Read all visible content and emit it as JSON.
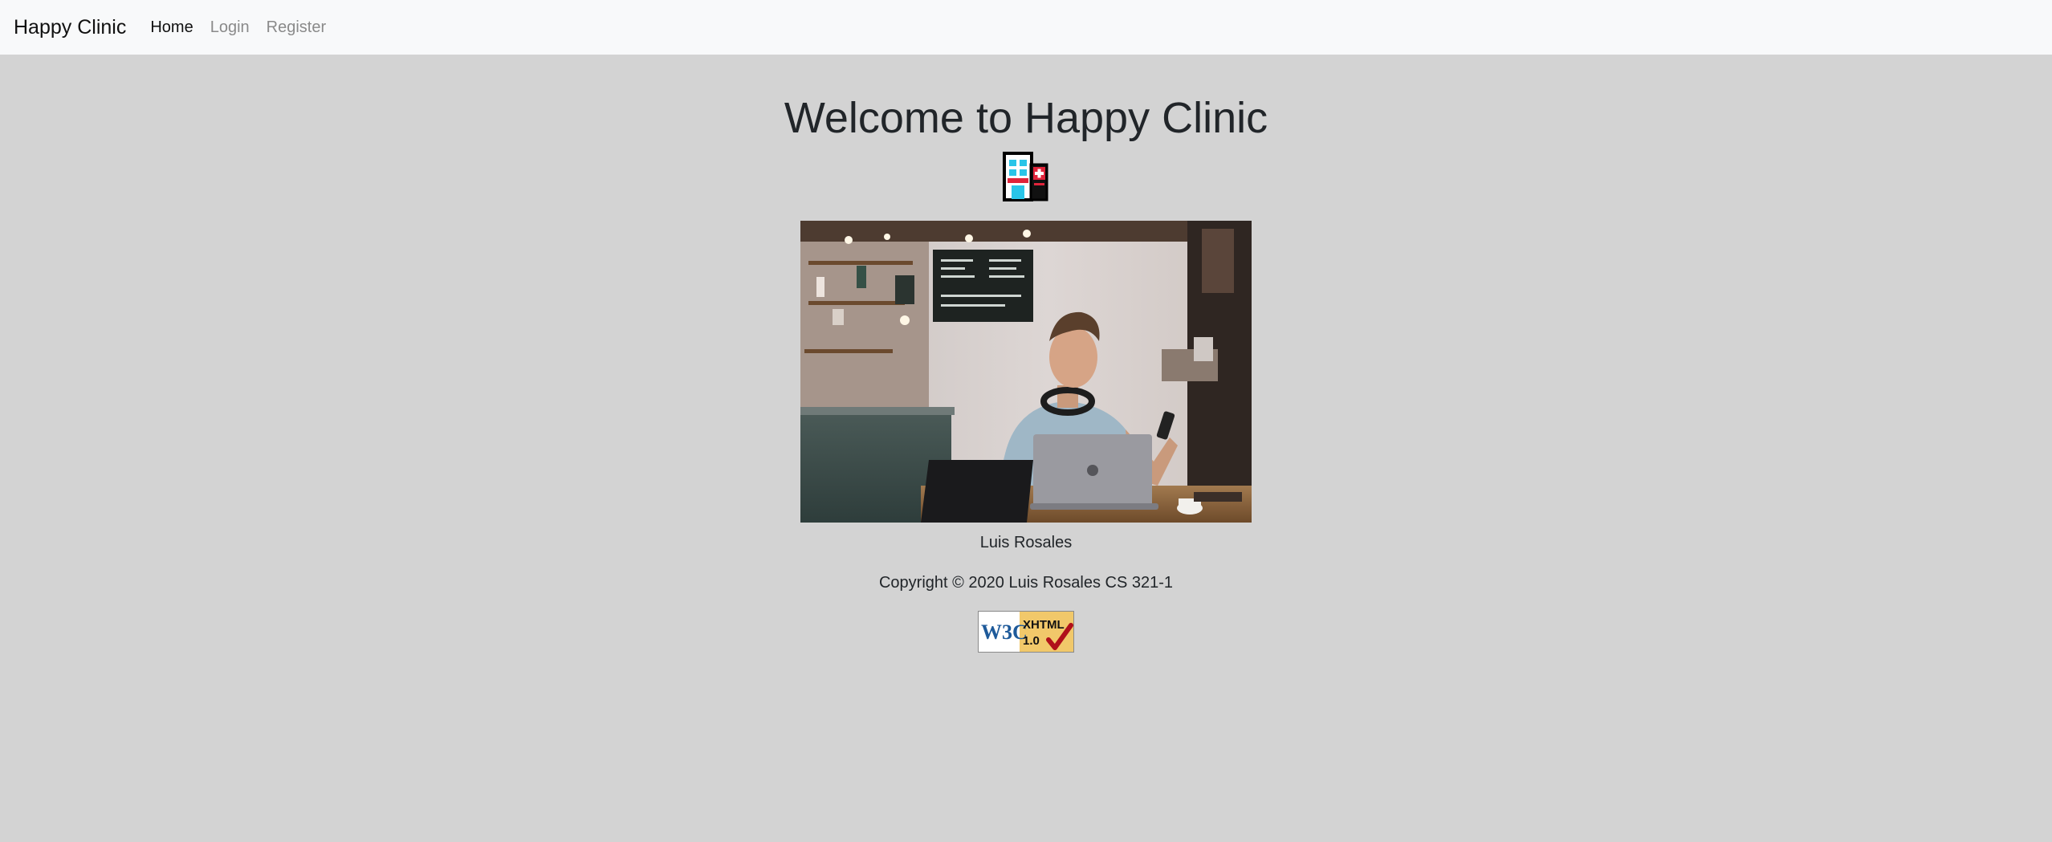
{
  "nav": {
    "brand": "Happy Clinic",
    "links": [
      {
        "label": "Home",
        "active": true
      },
      {
        "label": "Login",
        "active": false
      },
      {
        "label": "Register",
        "active": false
      }
    ]
  },
  "main": {
    "title": "Welcome to Happy Clinic",
    "icon": "hospital-icon",
    "photo_caption": "Luis Rosales",
    "copyright": "Copyright © 2020 Luis Rosales CS 321-1",
    "badge": {
      "org": "W3C",
      "label_line1": "XHTML",
      "label_line2": "1.0"
    }
  },
  "colors": {
    "background": "#d3d3d3",
    "navbar": "#f8f9fa",
    "text": "#212529",
    "nav_muted": "#8a8a8a"
  }
}
